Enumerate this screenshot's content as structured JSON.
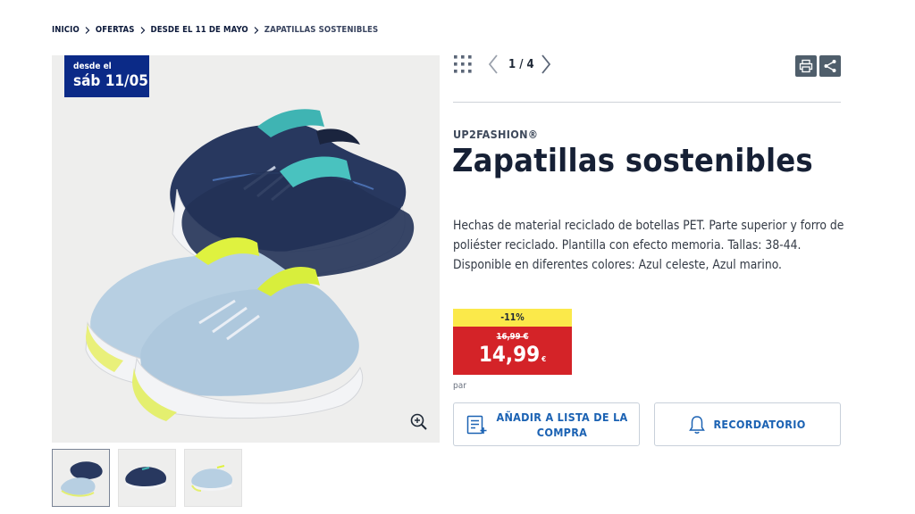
{
  "breadcrumb": [
    {
      "label": "INICIO"
    },
    {
      "label": "OFERTAS"
    },
    {
      "label": "DESDE EL 11 DE MAYO"
    },
    {
      "label": "ZAPATILLAS SOSTENIBLES"
    }
  ],
  "gallery": {
    "badge_line1": "desde el",
    "badge_line2": "sáb 11/05",
    "pager": "1 / 4"
  },
  "product": {
    "brand": "UP2FASHION®",
    "title": "Zapatillas sostenibles",
    "description": "Hechas de material reciclado de botellas PET. Parte superior y forro de poliéster reciclado. Plantilla con efecto memoria. Tallas: 38-44. Disponible en diferentes colores: Azul celeste, Azul marino.",
    "discount": "-11%",
    "old_price": "16,99 €",
    "price": "14,99",
    "currency": "€",
    "unit": "par"
  },
  "actions": {
    "add_to_list": "AÑADIR A LISTA DE LA COMPRA",
    "reminder": "RECORDATORIO"
  },
  "icons": {
    "grid": "grid-icon",
    "prev": "chevron-left-icon",
    "next": "chevron-right-icon",
    "print": "print-icon",
    "share": "share-icon",
    "zoom": "zoom-in-icon",
    "list": "shopping-list-icon",
    "bell": "bell-icon"
  },
  "colors": {
    "badge": "#0b2a87",
    "discount_bg": "#fbe94a",
    "price_bg": "#d42328",
    "action_text": "#1b62b3",
    "title": "#162035"
  }
}
